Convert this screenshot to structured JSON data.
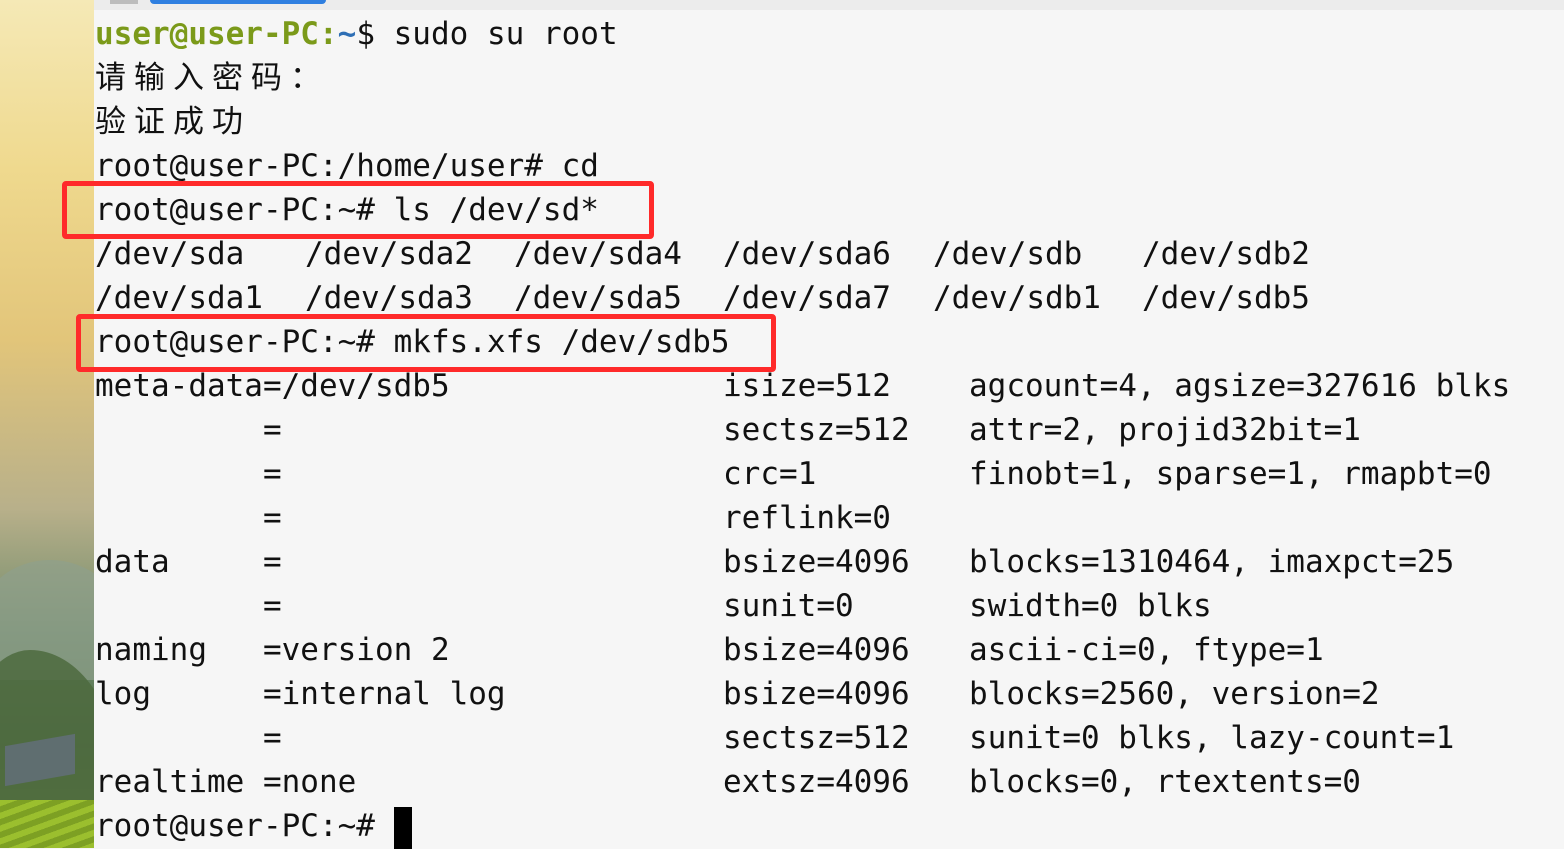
{
  "terminal": {
    "prompt_user_host": "user@user-PC",
    "prompt_colon": ":",
    "prompt_path": "~",
    "prompt_dollar": "$ ",
    "cmd_sudo": "sudo su root",
    "password_prompt": "请输入密码：",
    "auth_success": "验证成功",
    "line_cd": "root@user-PC:/home/user# cd",
    "line_ls": "root@user-PC:~# ls /dev/sd*",
    "ls_output": [
      [
        "/dev/sda",
        "/dev/sda2",
        "/dev/sda4",
        "/dev/sda6",
        "/dev/sdb",
        "/dev/sdb2"
      ],
      [
        "/dev/sda1",
        "/dev/sda3",
        "/dev/sda5",
        "/dev/sda7",
        "/dev/sdb1",
        "/dev/sdb5"
      ]
    ],
    "line_mkfs": "root@user-PC:~# mkfs.xfs /dev/sdb5",
    "mkfs_output": [
      {
        "c1": "meta-data=/dev/sdb5",
        "c2": "isize=512",
        "c3": "agcount=4, agsize=327616 blks"
      },
      {
        "c1": "         =",
        "c2": "sectsz=512",
        "c3": "attr=2, projid32bit=1"
      },
      {
        "c1": "         =",
        "c2": "crc=1",
        "c3": "finobt=1, sparse=1, rmapbt=0"
      },
      {
        "c1": "         =",
        "c2": "reflink=0",
        "c3": ""
      },
      {
        "c1": "data     =",
        "c2": "bsize=4096",
        "c3": "blocks=1310464, imaxpct=25"
      },
      {
        "c1": "         =",
        "c2": "sunit=0",
        "c3": "swidth=0 blks"
      },
      {
        "c1": "naming   =version 2",
        "c2": "bsize=4096",
        "c3": "ascii-ci=0, ftype=1"
      },
      {
        "c1": "log      =internal log",
        "c2": "bsize=4096",
        "c3": "blocks=2560, version=2"
      },
      {
        "c1": "         =",
        "c2": "sectsz=512",
        "c3": "sunit=0 blks, lazy-count=1"
      },
      {
        "c1": "realtime =none",
        "c2": "extsz=4096",
        "c3": "blocks=0, rtextents=0"
      }
    ],
    "final_prompt": "root@user-PC:~# "
  },
  "colors": {
    "highlight": "#ff2a2a",
    "prompt_user": "#7b9a1a",
    "prompt_path": "#2e6fb5",
    "background": "#f6f6f6"
  }
}
